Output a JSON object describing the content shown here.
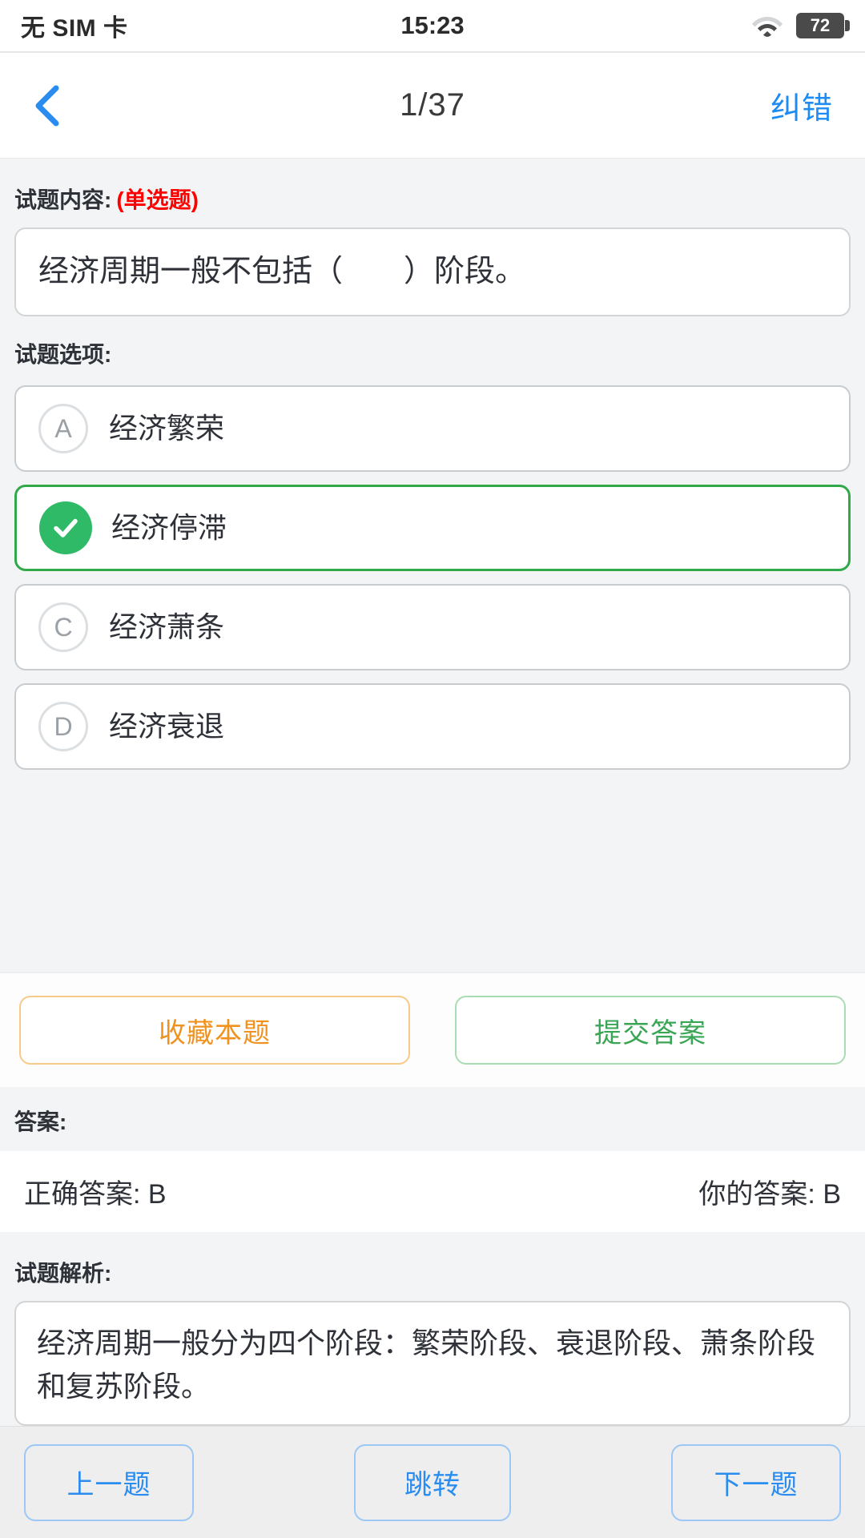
{
  "statusbar": {
    "carrier": "无 SIM 卡",
    "time": "15:23",
    "wifi_icon": "wifi-icon",
    "battery_level": "72"
  },
  "navbar": {
    "back_icon": "chevron-left-icon",
    "title": "1/37",
    "action_label": "纠错"
  },
  "question": {
    "label": "试题内容:",
    "type_tag": "(单选题)",
    "text": "经济周期一般不包括（　　）阶段。"
  },
  "options": {
    "label": "试题选项:",
    "items": [
      {
        "letter": "A",
        "text": "经济繁荣",
        "selected": false
      },
      {
        "letter": "B",
        "text": "经济停滞",
        "selected": true
      },
      {
        "letter": "C",
        "text": "经济萧条",
        "selected": false
      },
      {
        "letter": "D",
        "text": "经济衰退",
        "selected": false
      }
    ]
  },
  "actions": {
    "favorite_label": "收藏本题",
    "submit_label": "提交答案"
  },
  "answer": {
    "label": "答案:",
    "correct_text": "正确答案: B",
    "your_text": "你的答案: B"
  },
  "explanation": {
    "label": "试题解析:",
    "text": "经济周期一般分为四个阶段：繁荣阶段、衰退阶段、萧条阶段和复苏阶段。"
  },
  "bottom_nav": {
    "prev_label": "上一题",
    "jump_label": "跳转",
    "next_label": "下一题"
  },
  "colors": {
    "accent_blue": "#2b8cf0",
    "selected_green": "#2eba66",
    "selected_border_green": "#31a84a",
    "favorite_orange": "#f0921f",
    "submit_green": "#3aa655",
    "type_red": "#ff0000",
    "page_bg": "#f2f4f6"
  }
}
